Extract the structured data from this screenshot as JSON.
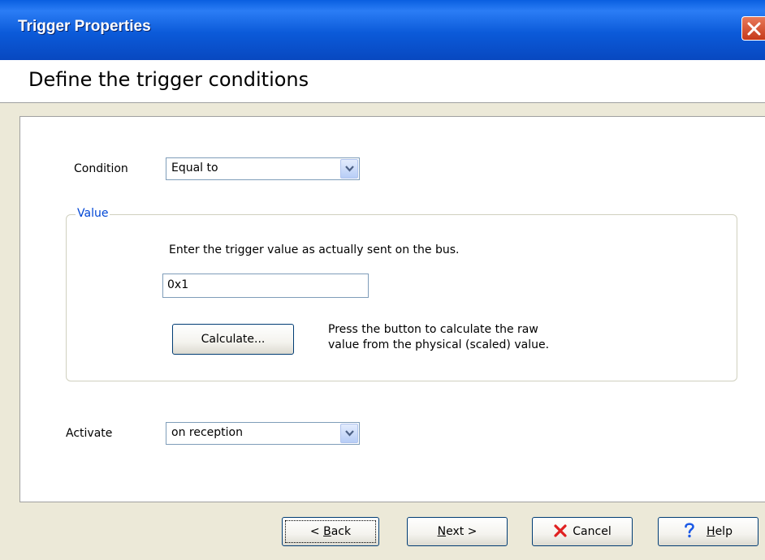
{
  "window": {
    "title": "Trigger Properties",
    "close_icon": "close-x-icon"
  },
  "header": {
    "title": "Define the trigger conditions"
  },
  "condition": {
    "label": "Condition",
    "selected": "Equal to"
  },
  "value_group": {
    "legend": "Value",
    "instruction": "Enter the trigger value as actually sent on the bus.",
    "input_value": "0x1",
    "calculate_label": "Calculate...",
    "calculate_hint_line1": "Press the button to calculate the raw",
    "calculate_hint_line2": "value from the physical (scaled) value."
  },
  "activate": {
    "label": "Activate",
    "selected": "on reception"
  },
  "buttons": {
    "back": {
      "prefix": "< ",
      "mnemonic": "B",
      "rest": "ack"
    },
    "next": {
      "mnemonic": "N",
      "rest": "ext >"
    },
    "cancel": {
      "label": "Cancel",
      "icon": "red-x-icon"
    },
    "help": {
      "mnemonic": "H",
      "rest": "elp",
      "icon": "question-mark-icon"
    }
  },
  "colors": {
    "titlebar": "#0a5fe0",
    "dialog_bg": "#ece9d8",
    "group_legend": "#0046d5",
    "cancel_icon": "#e02020",
    "help_icon": "#1c5ae6"
  }
}
